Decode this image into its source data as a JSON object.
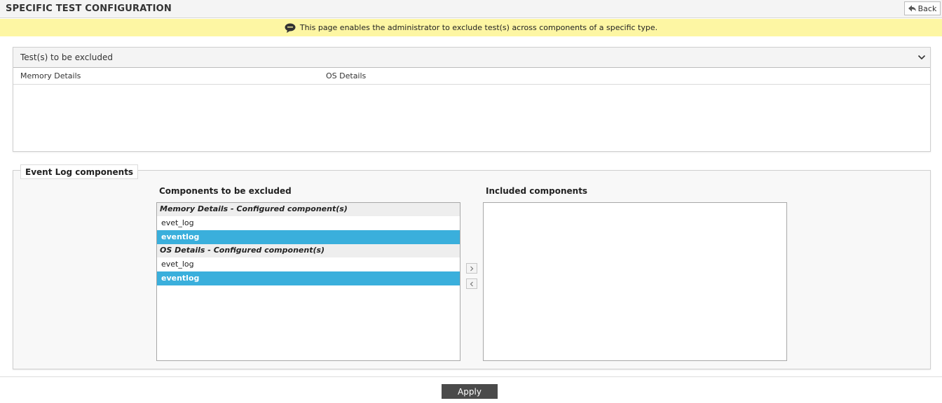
{
  "header": {
    "title": "SPECIFIC TEST CONFIGURATION",
    "back_label": "Back"
  },
  "notice": {
    "text": "This page enables the administrator to exclude test(s) across components of a specific type."
  },
  "tests_panel": {
    "title": "Test(s) to be excluded",
    "tests": [
      "Memory Details",
      "OS Details"
    ]
  },
  "components_section": {
    "legend": "Event Log components",
    "excluded_label": "Components to be excluded",
    "included_label": "Included components",
    "excluded_groups": [
      {
        "header": "Memory Details - Configured component(s)",
        "options": [
          {
            "label": "evet_log",
            "selected": false
          },
          {
            "label": "eventlog",
            "selected": true
          }
        ]
      },
      {
        "header": "OS Details - Configured component(s)",
        "options": [
          {
            "label": "evet_log",
            "selected": false
          },
          {
            "label": "eventlog",
            "selected": true
          }
        ]
      }
    ],
    "included_items": []
  },
  "footer": {
    "apply_label": "Apply"
  },
  "colors": {
    "notice_bg": "#fdf6a3",
    "selected_bg": "#3aafdc",
    "apply_bg": "#4a4a4a"
  }
}
